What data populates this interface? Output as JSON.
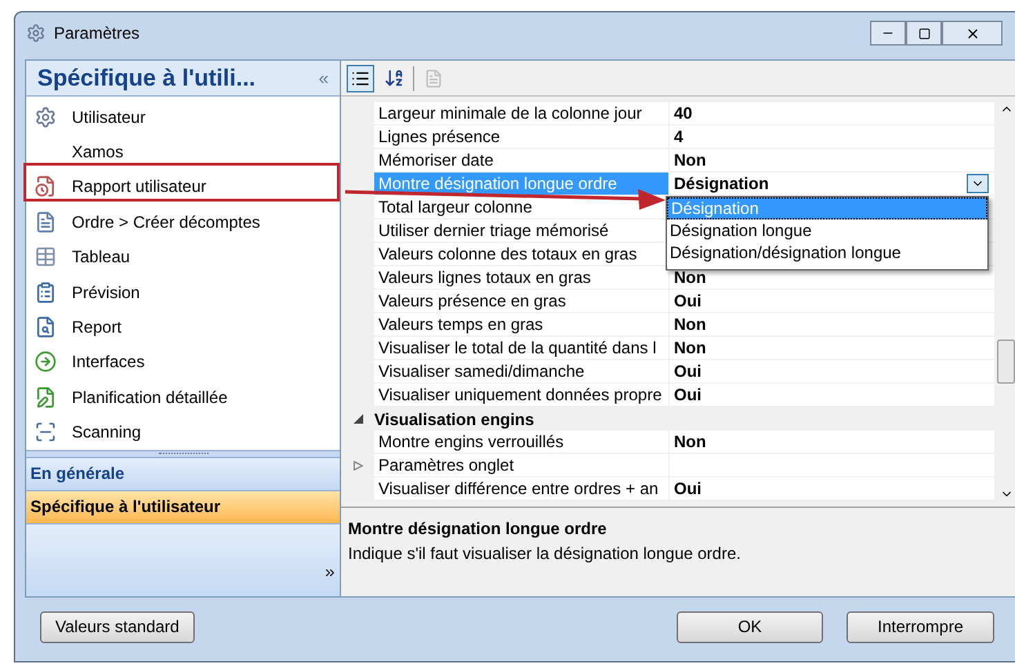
{
  "window": {
    "title": "Paramètres"
  },
  "sidebar": {
    "header": "Spécifique à l'utili...",
    "collapse": "«",
    "items": [
      {
        "label": "Utilisateur",
        "selected": false
      },
      {
        "label": "Xamos",
        "selected": false
      },
      {
        "label": "Rapport utilisateur",
        "selected": false
      },
      {
        "label": "Ordre > Créer décomptes",
        "selected": false
      },
      {
        "label": "Tableau",
        "selected": false
      },
      {
        "label": "Prévision",
        "selected": false
      },
      {
        "label": "Report",
        "selected": false
      },
      {
        "label": "Interfaces",
        "selected": false
      },
      {
        "label": "Planification détaillée",
        "selected": false
      },
      {
        "label": "Scanning",
        "selected": false
      }
    ],
    "sections": [
      {
        "label": "En générale",
        "selected": false
      },
      {
        "label": "Spécifique à l'utilisateur",
        "selected": true
      }
    ]
  },
  "properties": {
    "rows": [
      {
        "kind": "property",
        "name": "Largeur minimale de la colonne jour",
        "value": "40",
        "selected": false
      },
      {
        "kind": "property",
        "name": "Lignes présence",
        "value": "4",
        "selected": false
      },
      {
        "kind": "property",
        "name": "Mémoriser date",
        "value": "Non",
        "selected": false
      },
      {
        "kind": "property",
        "name": "Montre désignation longue ordre",
        "value": "Désignation",
        "selected": true
      },
      {
        "kind": "property",
        "name": "Total largeur colonne",
        "selected": false
      },
      {
        "kind": "property",
        "name": "Utiliser dernier triage mémorisé",
        "selected": false
      },
      {
        "kind": "property",
        "name": "Valeurs colonne des totaux en gras",
        "selected": false
      },
      {
        "kind": "property",
        "name": "Valeurs lignes totaux en gras",
        "value": "Non",
        "selected": false
      },
      {
        "kind": "property",
        "name": "Valeurs présence en gras",
        "value": "Oui",
        "selected": false
      },
      {
        "kind": "property",
        "name": "Valeurs temps en gras",
        "value": "Non",
        "selected": false
      },
      {
        "kind": "property",
        "name": "Visualiser le total de la quantité dans l",
        "value": "Non",
        "selected": false
      },
      {
        "kind": "property",
        "name": "Visualiser samedi/dimanche",
        "value": "Oui",
        "selected": false
      },
      {
        "kind": "property",
        "name": "Visualiser uniquement données propre",
        "value": "Oui",
        "selected": false
      },
      {
        "kind": "category",
        "name": "Visualisation engins",
        "expanded": true
      },
      {
        "kind": "property",
        "name": "Montre engins verrouillés",
        "value": "Non",
        "selected": false
      },
      {
        "kind": "group",
        "name": "Paramètres onglet",
        "expanded": false
      },
      {
        "kind": "property",
        "name": "Visualiser différence entre ordres + an",
        "value": "Oui",
        "selected": false
      }
    ],
    "dropdown": [
      {
        "label": "Désignation",
        "selected": true
      },
      {
        "label": "Désignation longue",
        "selected": false
      },
      {
        "label": "Désignation/désignation longue",
        "selected": false
      }
    ],
    "description": {
      "title": "Montre désignation longue ordre",
      "text": "Indique s'il faut visualiser la désignation longue ordre."
    }
  },
  "buttons": {
    "left": "Valeurs standard",
    "ok": "OK",
    "cancel": "Interrompre"
  }
}
